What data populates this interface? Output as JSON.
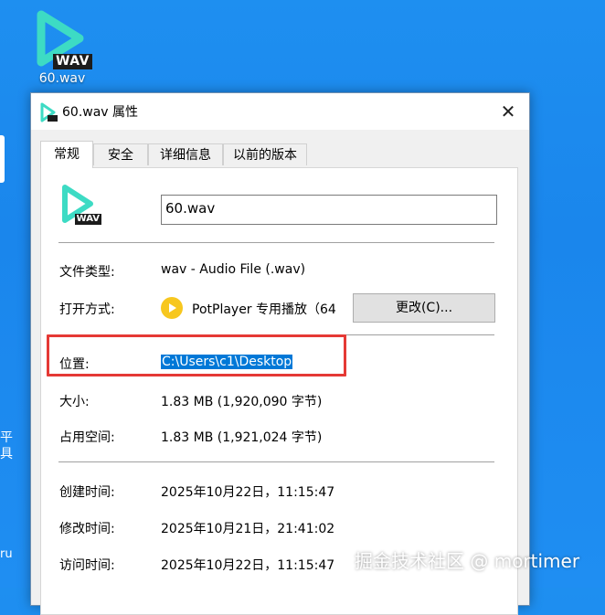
{
  "desktop": {
    "file_icon_badge": "WAV",
    "file_icon_label": "60.wav",
    "edge_text_lines": [
      "平",
      "具"
    ],
    "edge_text_bottom": "ru"
  },
  "dialog": {
    "title": "60.wav 属性",
    "close_glyph": "✕",
    "tabs": [
      {
        "label": "常规",
        "active": true
      },
      {
        "label": "安全",
        "active": false
      },
      {
        "label": "详细信息",
        "active": false
      },
      {
        "label": "以前的版本",
        "active": false
      }
    ],
    "general": {
      "icon_badge": "WAV",
      "file_name": "60.wav",
      "file_type_label": "文件类型:",
      "file_type_value": "wav - Audio File (.wav)",
      "open_with_label": "打开方式:",
      "open_with_value": "PotPlayer 专用播放（64",
      "change_button": "更改(C)...",
      "location_label": "位置:",
      "location_value": "C:\\Users\\c1\\Desktop",
      "size_label": "大小:",
      "size_value": "1.83 MB (1,920,090 字节)",
      "disk_size_label": "占用空间:",
      "disk_size_value": "1.83 MB (1,921,024 字节)",
      "created_label": "创建时间:",
      "created_value": "2025年10月22日，11:15:47",
      "modified_label": "修改时间:",
      "modified_value": "2025年10月21日，21:41:02",
      "accessed_label": "访问时间:",
      "accessed_value": "2025年10月22日，11:15:47"
    }
  },
  "overlay": {
    "watermark": "掘金技术社区 @ mortimer",
    "highlight_color": "#e53935"
  },
  "colors": {
    "desktop_bg": "#1a86ec",
    "selection_bg": "#0078d7",
    "icon_play_color": "#3ddbc4",
    "potplayer_color": "#f7c71f"
  }
}
